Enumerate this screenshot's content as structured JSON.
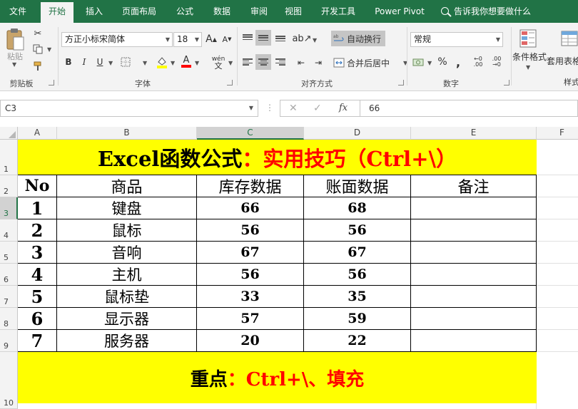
{
  "ribbon_tabs": [
    "文件",
    "开始",
    "插入",
    "页面布局",
    "公式",
    "数据",
    "审阅",
    "视图",
    "开发工具",
    "Power Pivot"
  ],
  "active_tab": "开始",
  "tell_me": "告诉我你想要做什么",
  "clipboard": {
    "paste_label": "粘贴",
    "group_label": "剪贴板"
  },
  "font": {
    "name": "方正小标宋简体",
    "size": "18",
    "group_label": "字体",
    "bold": "B",
    "italic": "I",
    "underline": "U",
    "grow": "A",
    "shrink": "A",
    "font_color": "A",
    "wen": "wén"
  },
  "alignment": {
    "wrap_text": "自动换行",
    "merge_center": "合并后居中",
    "group_label": "对齐方式"
  },
  "number": {
    "format": "常规",
    "percent": "%",
    "comma": ",",
    "group_label": "数字"
  },
  "styles": {
    "conditional_format": "条件格式",
    "table_format": "套用表格格式",
    "cell_styles": "样式"
  },
  "formula_bar": {
    "name_box": "C3",
    "value": "66",
    "fx": "fx"
  },
  "columns": [
    "A",
    "B",
    "C",
    "D",
    "E",
    "F"
  ],
  "rows": [
    "1",
    "2",
    "3",
    "4",
    "5",
    "6",
    "7",
    "8",
    "9",
    "10"
  ],
  "active_cell": {
    "column": "C",
    "row": "3"
  },
  "sheet": {
    "title_black": "Excel函数公式",
    "title_red": "：实用技巧（Ctrl+\\）",
    "headers": [
      "No",
      "商品",
      "库存数据",
      "账面数据",
      "备注"
    ],
    "rows": [
      [
        "1",
        "键盘",
        "66",
        "68",
        ""
      ],
      [
        "2",
        "鼠标",
        "56",
        "56",
        ""
      ],
      [
        "3",
        "音响",
        "67",
        "67",
        ""
      ],
      [
        "4",
        "主机",
        "56",
        "56",
        ""
      ],
      [
        "5",
        "鼠标垫",
        "33",
        "35",
        ""
      ],
      [
        "6",
        "显示器",
        "57",
        "59",
        ""
      ],
      [
        "7",
        "服务器",
        "20",
        "22",
        ""
      ]
    ],
    "footer_black": "重点",
    "footer_red": "：Ctrl+\\、填充"
  },
  "colors": {
    "excel_green": "#217346",
    "band_yellow": "#ffff00",
    "accent_red": "#ff0000"
  }
}
